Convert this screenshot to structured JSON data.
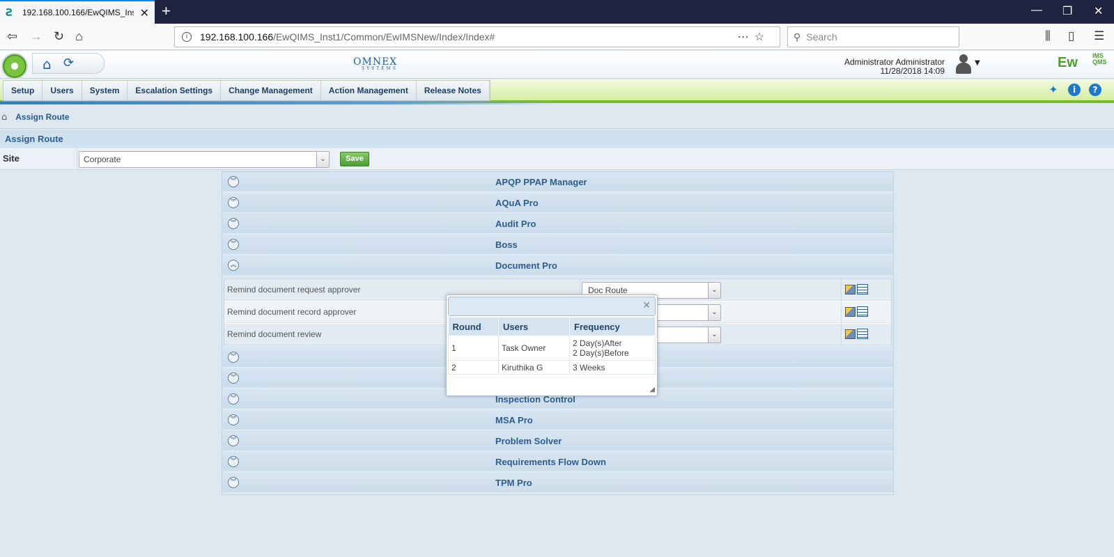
{
  "browser": {
    "tab_title": "192.168.100.166/EwQIMS_Inst1/",
    "url_host": "192.168.100.166",
    "url_path": "/EwQIMS_Inst1/Common/EwIMSNew/Index/Index#",
    "search_placeholder": "Search"
  },
  "header": {
    "company_logo": "OMNEX",
    "company_logo_sub": "SYSTEMS",
    "user_name": "Administrator Administrator",
    "datetime": "11/28/2018 14:09",
    "product_logo": "Ew",
    "product_logo_sup": "IMS QMS"
  },
  "menu": {
    "items": [
      "Setup",
      "Users",
      "System",
      "Escalation Settings",
      "Change Management",
      "Action Management",
      "Release Notes"
    ]
  },
  "breadcrumb": {
    "current": "Assign Route"
  },
  "page": {
    "title": "Assign Route",
    "site_label": "Site",
    "site_value": "Corporate",
    "save_label": "Save"
  },
  "accordion": {
    "sections_top": [
      "APQP PPAP Manager",
      "AQuA Pro",
      "Audit Pro",
      "Boss",
      "Document Pro"
    ],
    "sections_hidden": [
      "",
      ""
    ],
    "sections_bottom": [
      "Inspection Control",
      "MSA Pro",
      "Problem Solver",
      "Requirements Flow Down",
      "TPM Pro"
    ],
    "document_pro_rows": [
      {
        "label": "Remind document request approver",
        "route": "Doc Route"
      },
      {
        "label": "Remind document record approver",
        "route": ""
      },
      {
        "label": "Remind document review",
        "route": ""
      }
    ]
  },
  "popup": {
    "columns": [
      "Round",
      "Users",
      "Frequency"
    ],
    "rows": [
      {
        "round": "1",
        "users": "Task Owner",
        "frequency_1": "2 Day(s)After",
        "frequency_2": "2 Day(s)Before"
      },
      {
        "round": "2",
        "users": "Kiruthika G",
        "frequency_1": "3 Weeks",
        "frequency_2": ""
      }
    ]
  }
}
